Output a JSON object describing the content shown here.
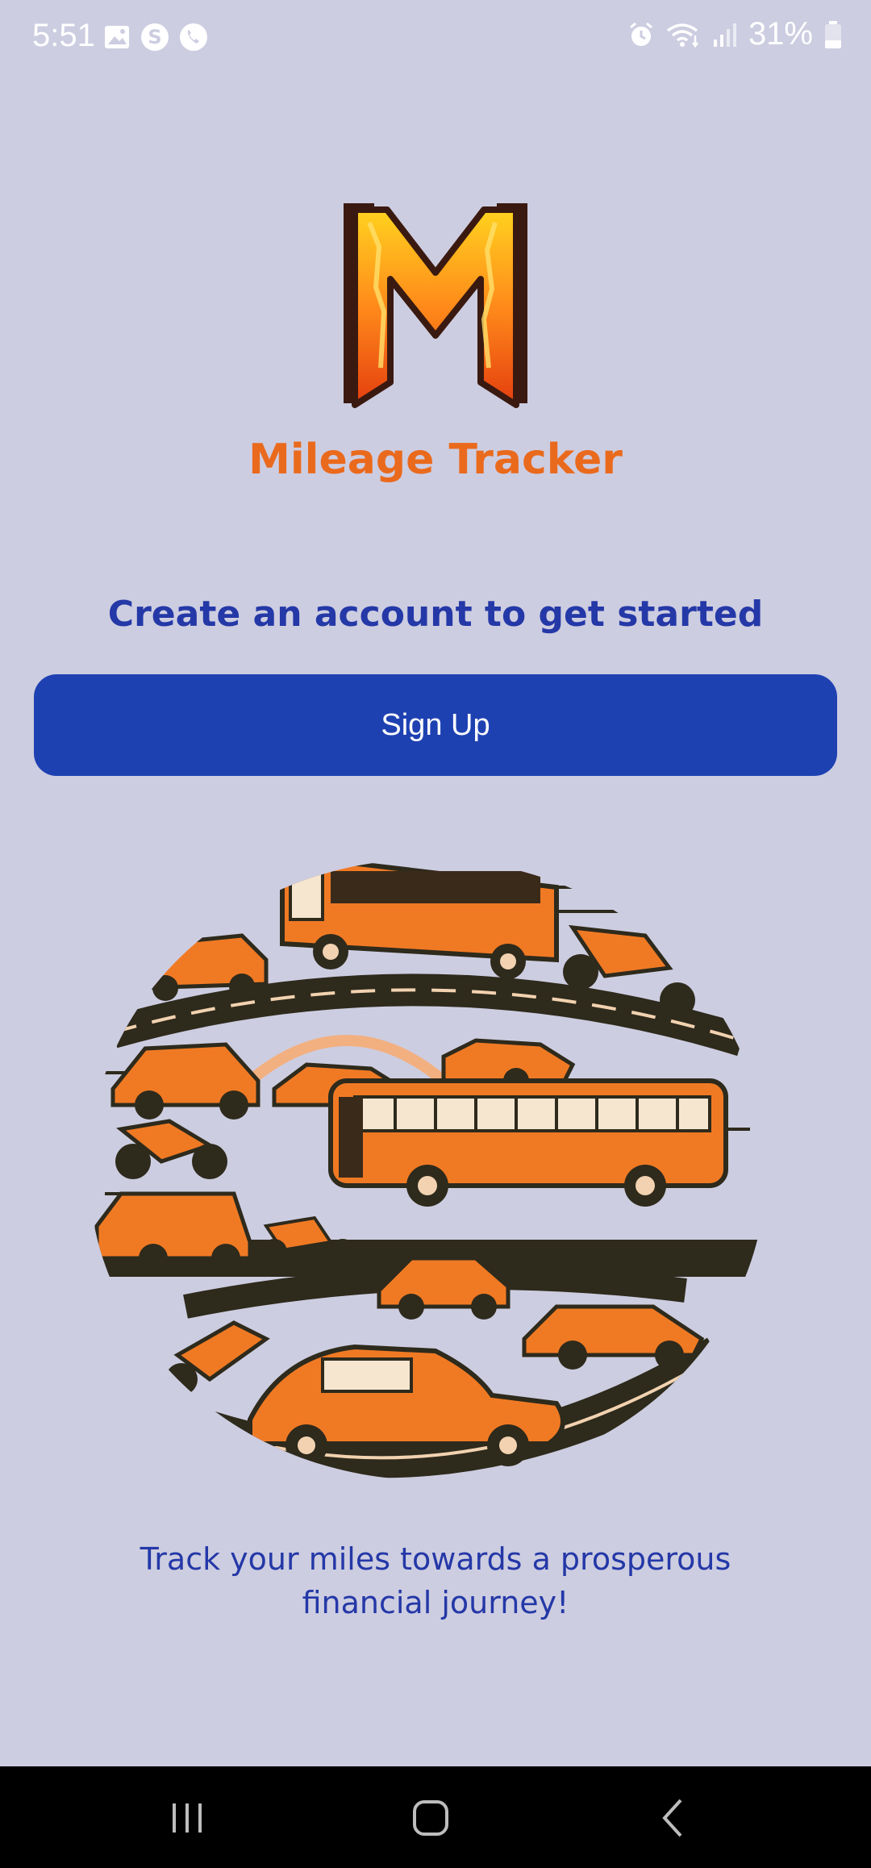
{
  "status_bar": {
    "time": "5:51",
    "battery": "31%",
    "left_icons": [
      "gallery-icon",
      "skype-icon",
      "viber-icon"
    ],
    "right_icons": [
      "alarm-icon",
      "wifi-icon",
      "signal-icon",
      "battery-icon"
    ]
  },
  "app": {
    "name": "Mileage Tracker",
    "logo_icon": "mileage-m-logo-icon"
  },
  "onboarding": {
    "subtitle": "Create an account to get started",
    "signup_label": "Sign Up",
    "tagline": "Track your miles towards a prosperous financial journey!"
  },
  "illustration": {
    "icon": "vehicles-road-illustration"
  },
  "nav_bar": {
    "buttons": [
      "recent-apps-icon",
      "home-icon",
      "back-icon"
    ]
  },
  "colors": {
    "background": "#cdcde1",
    "brand_orange": "#ea6a1d",
    "primary_blue": "#1e41b2",
    "text_blue": "#2438a7"
  }
}
